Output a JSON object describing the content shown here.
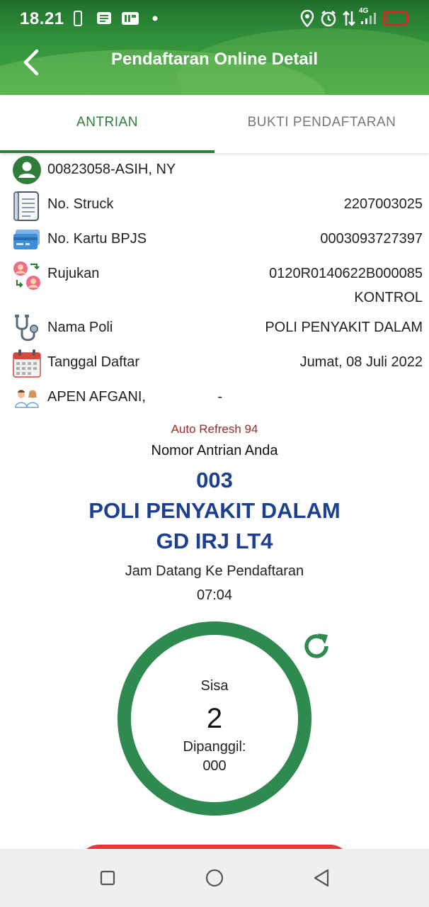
{
  "status_bar": {
    "time": "18.21",
    "network": "4G"
  },
  "app_bar": {
    "title": "Pendaftaran Online Detail"
  },
  "tabs": [
    {
      "label": "ANTRIAN",
      "active": true
    },
    {
      "label": "BUKTI PENDAFTARAN",
      "active": false
    }
  ],
  "patient": {
    "id_name": "00823058-ASIH, NY"
  },
  "details": {
    "struck": {
      "label": "No. Struck",
      "value": "2207003025"
    },
    "bpjs": {
      "label": "No. Kartu BPJS",
      "value": "0003093727397"
    },
    "rujukan": {
      "label": "Rujukan",
      "value": "0120R0140622B000085",
      "note": "KONTROL"
    },
    "poli": {
      "label": "Nama Poli",
      "value": "POLI PENYAKIT DALAM"
    },
    "tanggal": {
      "label": "Tanggal Daftar",
      "value": "Jumat, 08 Juli 2022"
    },
    "dokter": {
      "label": "APEN AFGANI,",
      "value": "-"
    }
  },
  "queue": {
    "auto_refresh": "Auto Refresh 94",
    "nomor_label": "Nomor Antrian Anda",
    "number": "003",
    "poli": "POLI PENYAKIT DALAM",
    "location": "GD IRJ LT4",
    "jam_label": "Jam Datang Ke Pendaftaran",
    "jam_value": "07:04",
    "sisa_label": "Sisa",
    "sisa_value": "2",
    "dipanggil_label": "Dipanggil:",
    "dipanggil_value": "000"
  },
  "colors": {
    "primary_green": "#2e7d3a",
    "ring_green": "#2e8a4f",
    "queue_blue": "#1c3f8f",
    "auto_refresh_red": "#a12a2a",
    "button_red": "#e53939"
  }
}
